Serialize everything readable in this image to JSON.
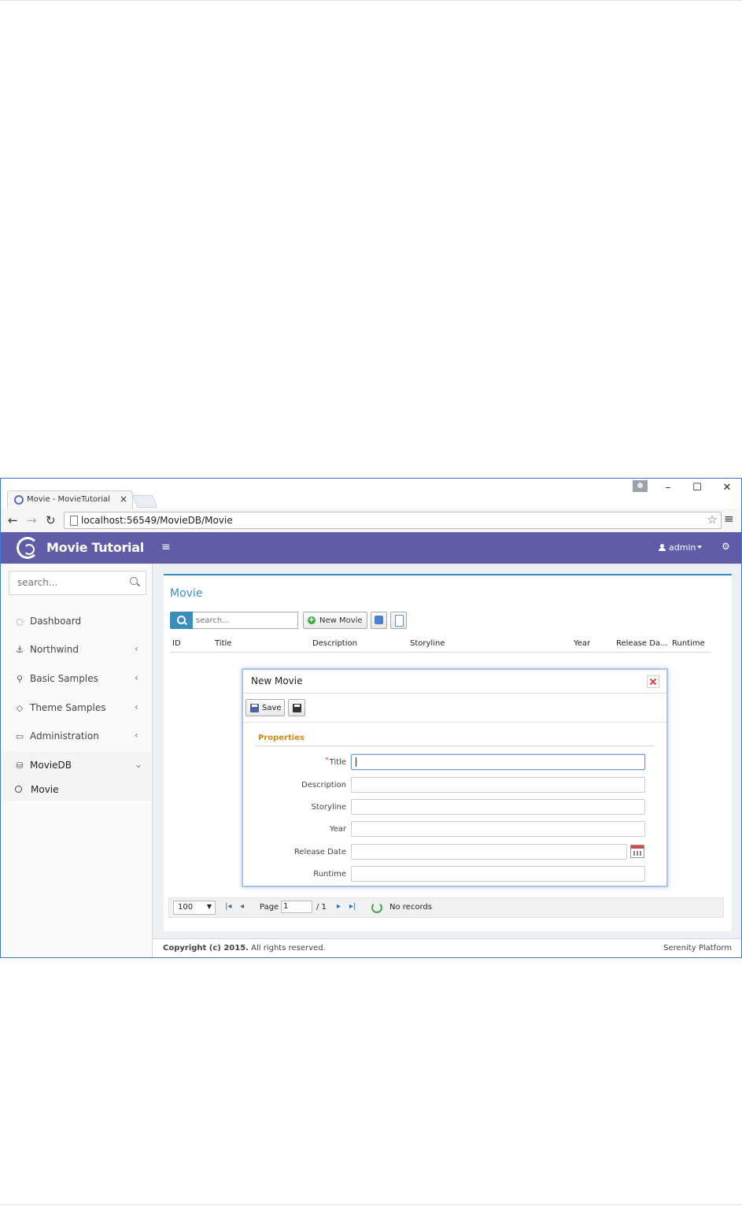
{
  "browser": {
    "tab_title": "Movie - MovieTutorial",
    "tab_close": "×",
    "url": "localhost:56549/MovieDB/Movie",
    "controls": {
      "minimize": "–",
      "maximize": "☐",
      "close": "✕"
    }
  },
  "header": {
    "app_title": "Movie Tutorial",
    "menu_icon": "≡",
    "user": "admin",
    "settings_icon": "⚙"
  },
  "sidebar": {
    "search_placeholder": "search...",
    "items": [
      {
        "label": "Dashboard",
        "icon": "◌",
        "chevron": ""
      },
      {
        "label": "Northwind",
        "icon": "⚓",
        "chevron": "‹"
      },
      {
        "label": "Basic Samples",
        "icon": "⚲",
        "chevron": "‹"
      },
      {
        "label": "Theme Samples",
        "icon": "◇",
        "chevron": "‹"
      },
      {
        "label": "Administration",
        "icon": "▭",
        "chevron": "‹"
      },
      {
        "label": "MovieDB",
        "icon": "⛁",
        "chevron": "⌄"
      }
    ],
    "sub_items": [
      {
        "label": "Movie"
      }
    ]
  },
  "page": {
    "title": "Movie",
    "search_placeholder": "search...",
    "new_button": "New Movie",
    "columns": [
      "ID",
      "Title",
      "Description",
      "Storyline",
      "Year",
      "Release Da...",
      "Runtime"
    ]
  },
  "pager": {
    "page_size": "100",
    "page_label": "Page",
    "page_value": "1",
    "page_total": "/ 1",
    "status": "No records",
    "first": "|◂",
    "prev": "◂",
    "next": "▸",
    "last": "▸|"
  },
  "footer": {
    "copyright_bold": "Copyright (c) 2015.",
    "copyright_rest": " All rights reserved.",
    "platform": "Serenity Platform"
  },
  "dialog": {
    "title": "New Movie",
    "save_label": "Save",
    "category": "Properties",
    "required_mark": "*",
    "fields": [
      {
        "label": "Title",
        "value": ""
      },
      {
        "label": "Description",
        "value": ""
      },
      {
        "label": "Storyline",
        "value": ""
      },
      {
        "label": "Year",
        "value": ""
      },
      {
        "label": "Release Date",
        "value": ""
      },
      {
        "label": "Runtime",
        "value": ""
      }
    ]
  },
  "colors": {
    "header": "#605ca8",
    "accent": "#3c8dbc",
    "category": "#d08a12",
    "required": "#e23b3b"
  }
}
